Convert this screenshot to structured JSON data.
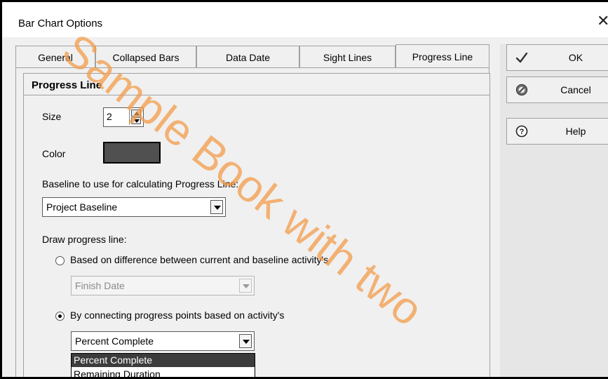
{
  "window": {
    "title": "Bar Chart Options",
    "close_glyph": "✕"
  },
  "tabs": [
    {
      "label": "General"
    },
    {
      "label": "Collapsed Bars"
    },
    {
      "label": "Data Date"
    },
    {
      "label": "Sight Lines"
    },
    {
      "label": "Progress Line",
      "active": true
    }
  ],
  "section": {
    "title": "Progress Line"
  },
  "size": {
    "label": "Size",
    "value": "2"
  },
  "color": {
    "label": "Color",
    "swatch": "#505050"
  },
  "baseline": {
    "label": "Baseline to use for calculating Progress Line:",
    "value": "Project Baseline"
  },
  "draw": {
    "label": "Draw progress line:",
    "option1": {
      "label": "Based on difference between current and baseline activity's",
      "checked": false,
      "select_value": "Finish Date"
    },
    "option2": {
      "label": "By connecting progress points based on activity's",
      "checked": true,
      "select_value": "Percent Complete"
    }
  },
  "dropdown": {
    "options": [
      "Percent Complete",
      "Remaining Duration"
    ],
    "selected": "Percent Complete"
  },
  "buttons": {
    "ok": "OK",
    "cancel": "Cancel",
    "help": "Help"
  },
  "watermark": "Sample Book with two"
}
